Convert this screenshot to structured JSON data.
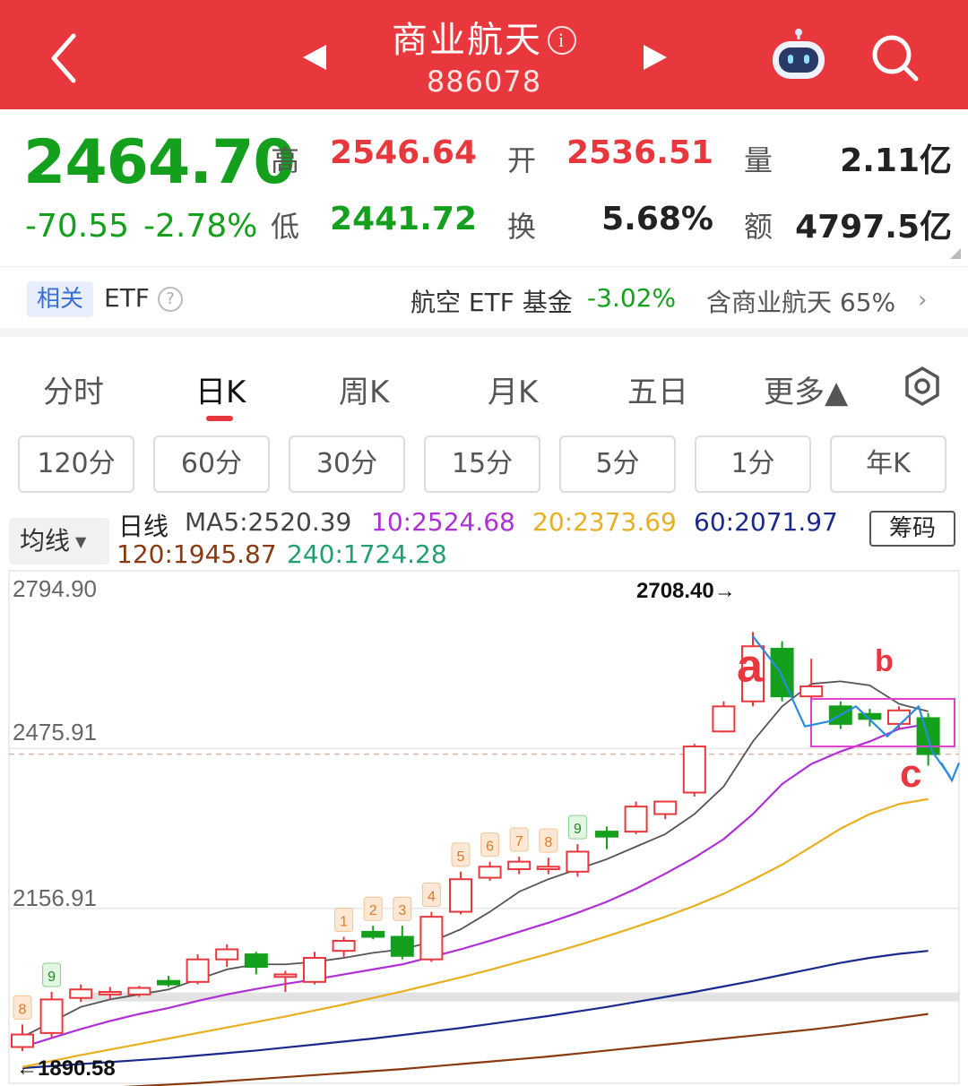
{
  "header": {
    "title": "商业航天",
    "info_symbol": "i",
    "code": "886078"
  },
  "quote": {
    "price": "2464.70",
    "change": "-70.55",
    "change_pct": "-2.78%",
    "high_label": "高",
    "high": "2546.64",
    "low_label": "低",
    "low": "2441.72",
    "open_label": "开",
    "open": "2536.51",
    "turnover_label": "换",
    "turnover": "5.68%",
    "volume_label": "量",
    "volume": "2.11亿",
    "amount_label": "额",
    "amount": "4797.5亿"
  },
  "etf": {
    "tag": "相关",
    "label": "ETF",
    "help_symbol": "?",
    "fund": "航空 ETF 基金",
    "fund_change": "-3.02%",
    "holding": "含商业航天 65%"
  },
  "tabs": [
    "分时",
    "日K",
    "周K",
    "月K",
    "五日",
    "更多▲"
  ],
  "minute_chips": [
    "120分",
    "60分",
    "30分",
    "15分",
    "5分",
    "1分",
    "年K"
  ],
  "ma_legend": {
    "selector": "均线",
    "title": "日线",
    "ma5": "MA5:2520.39",
    "ma10": "10:2524.68",
    "ma20": "20:2373.69",
    "ma60": "60:2071.97",
    "ma120": "120:1945.87",
    "ma240": "240:1724.28",
    "chip_button": "筹码"
  },
  "colors": {
    "header_red": "#e8383d",
    "up": "#e8383d",
    "down": "#14a01c",
    "ma5": "#555555",
    "ma10": "#b030d8",
    "ma20": "#e8b020",
    "ma60": "#1a2a8c",
    "ma120": "#8a3a10",
    "ma240": "#20a070"
  },
  "chart_data": {
    "type": "candlestick",
    "y_ticks": [
      "2794.90",
      "2475.91",
      "2156.91"
    ],
    "ylim": [
      1838,
      2794.9
    ],
    "high_marker": "2708.40→",
    "low_marker": "←1890.58",
    "annotations": [
      "a",
      "b",
      "c"
    ],
    "countdown_labels": [
      "8",
      "9",
      "1",
      "2",
      "3",
      "4",
      "5",
      "6",
      "7",
      "8",
      "9"
    ],
    "candles": [
      {
        "o": 1880,
        "h": 1925,
        "l": 1872,
        "c": 1905
      },
      {
        "o": 1908,
        "h": 1990,
        "l": 1900,
        "c": 1975
      },
      {
        "o": 1978,
        "h": 2005,
        "l": 1970,
        "c": 1995
      },
      {
        "o": 1985,
        "h": 2000,
        "l": 1975,
        "c": 1990
      },
      {
        "o": 1985,
        "h": 2002,
        "l": 1980,
        "c": 1998
      },
      {
        "o": 2012,
        "h": 2022,
        "l": 2000,
        "c": 2005
      },
      {
        "o": 2010,
        "h": 2065,
        "l": 2005,
        "c": 2055
      },
      {
        "o": 2055,
        "h": 2085,
        "l": 2040,
        "c": 2075
      },
      {
        "o": 2065,
        "h": 2070,
        "l": 2025,
        "c": 2040
      },
      {
        "o": 2020,
        "h": 2032,
        "l": 1990,
        "c": 2025
      },
      {
        "o": 2010,
        "h": 2070,
        "l": 2005,
        "c": 2058
      },
      {
        "o": 2072,
        "h": 2100,
        "l": 2060,
        "c": 2092
      },
      {
        "o": 2110,
        "h": 2122,
        "l": 2095,
        "c": 2100
      },
      {
        "o": 2100,
        "h": 2122,
        "l": 2055,
        "c": 2062
      },
      {
        "o": 2055,
        "h": 2150,
        "l": 2050,
        "c": 2140
      },
      {
        "o": 2150,
        "h": 2230,
        "l": 2145,
        "c": 2215
      },
      {
        "o": 2218,
        "h": 2250,
        "l": 2212,
        "c": 2240
      },
      {
        "o": 2235,
        "h": 2260,
        "l": 2225,
        "c": 2250
      },
      {
        "o": 2235,
        "h": 2258,
        "l": 2225,
        "c": 2240
      },
      {
        "o": 2230,
        "h": 2285,
        "l": 2220,
        "c": 2270
      },
      {
        "o": 2310,
        "h": 2320,
        "l": 2275,
        "c": 2300
      },
      {
        "o": 2310,
        "h": 2370,
        "l": 2305,
        "c": 2360
      },
      {
        "o": 2345,
        "h": 2370,
        "l": 2335,
        "c": 2370
      },
      {
        "o": 2388,
        "h": 2485,
        "l": 2380,
        "c": 2480
      },
      {
        "o": 2510,
        "h": 2570,
        "l": 2508,
        "c": 2560
      },
      {
        "o": 2570,
        "h": 2708.4,
        "l": 2560,
        "c": 2680
      },
      {
        "o": 2675,
        "h": 2690,
        "l": 2570,
        "c": 2580
      },
      {
        "o": 2580,
        "h": 2655,
        "l": 2568,
        "c": 2600
      },
      {
        "o": 2560,
        "h": 2570,
        "l": 2515,
        "c": 2525
      },
      {
        "o": 2545,
        "h": 2555,
        "l": 2520,
        "c": 2535
      },
      {
        "o": 2525,
        "h": 2560,
        "l": 2515,
        "c": 2552
      },
      {
        "o": 2536.51,
        "h": 2546.64,
        "l": 2441.72,
        "c": 2464.7
      }
    ],
    "ma5": [
      1900,
      1930,
      1960,
      1975,
      1985,
      1995,
      2015,
      2035,
      2045,
      2045,
      2050,
      2058,
      2068,
      2075,
      2090,
      2115,
      2150,
      2190,
      2215,
      2235,
      2255,
      2280,
      2305,
      2345,
      2400,
      2490,
      2560,
      2605,
      2610,
      2602,
      2565,
      2550
    ],
    "ma10": [
      1880,
      1898,
      1916,
      1932,
      1946,
      1958,
      1972,
      1985,
      1996,
      2006,
      2015,
      2025,
      2035,
      2045,
      2060,
      2075,
      2092,
      2110,
      2128,
      2148,
      2170,
      2196,
      2226,
      2258,
      2295,
      2345,
      2405,
      2445,
      2470,
      2490,
      2515,
      2525
    ],
    "ma20": [
      1840,
      1852,
      1864,
      1875,
      1886,
      1897,
      1908,
      1919,
      1930,
      1941,
      1953,
      1965,
      1978,
      1991,
      2005,
      2019,
      2034,
      2050,
      2066,
      2083,
      2101,
      2120,
      2140,
      2162,
      2186,
      2214,
      2244,
      2280,
      2316,
      2345,
      2365,
      2375
    ],
    "ma60": [
      1838,
      1842,
      1846,
      1850,
      1854,
      1858,
      1863,
      1868,
      1873,
      1879,
      1885,
      1891,
      1897,
      1904,
      1911,
      1918,
      1926,
      1934,
      1942,
      1951,
      1960,
      1970,
      1980,
      1990,
      2001,
      2012,
      2024,
      2036,
      2048,
      2058,
      2066,
      2072
    ],
    "ma120": [
      1790,
      1793,
      1796,
      1799,
      1802,
      1805,
      1808,
      1812,
      1816,
      1820,
      1824,
      1828,
      1832,
      1836,
      1841,
      1846,
      1851,
      1856,
      1861,
      1867,
      1873,
      1879,
      1885,
      1891,
      1897,
      1903,
      1909,
      1915,
      1922,
      1930,
      1938,
      1946
    ]
  }
}
